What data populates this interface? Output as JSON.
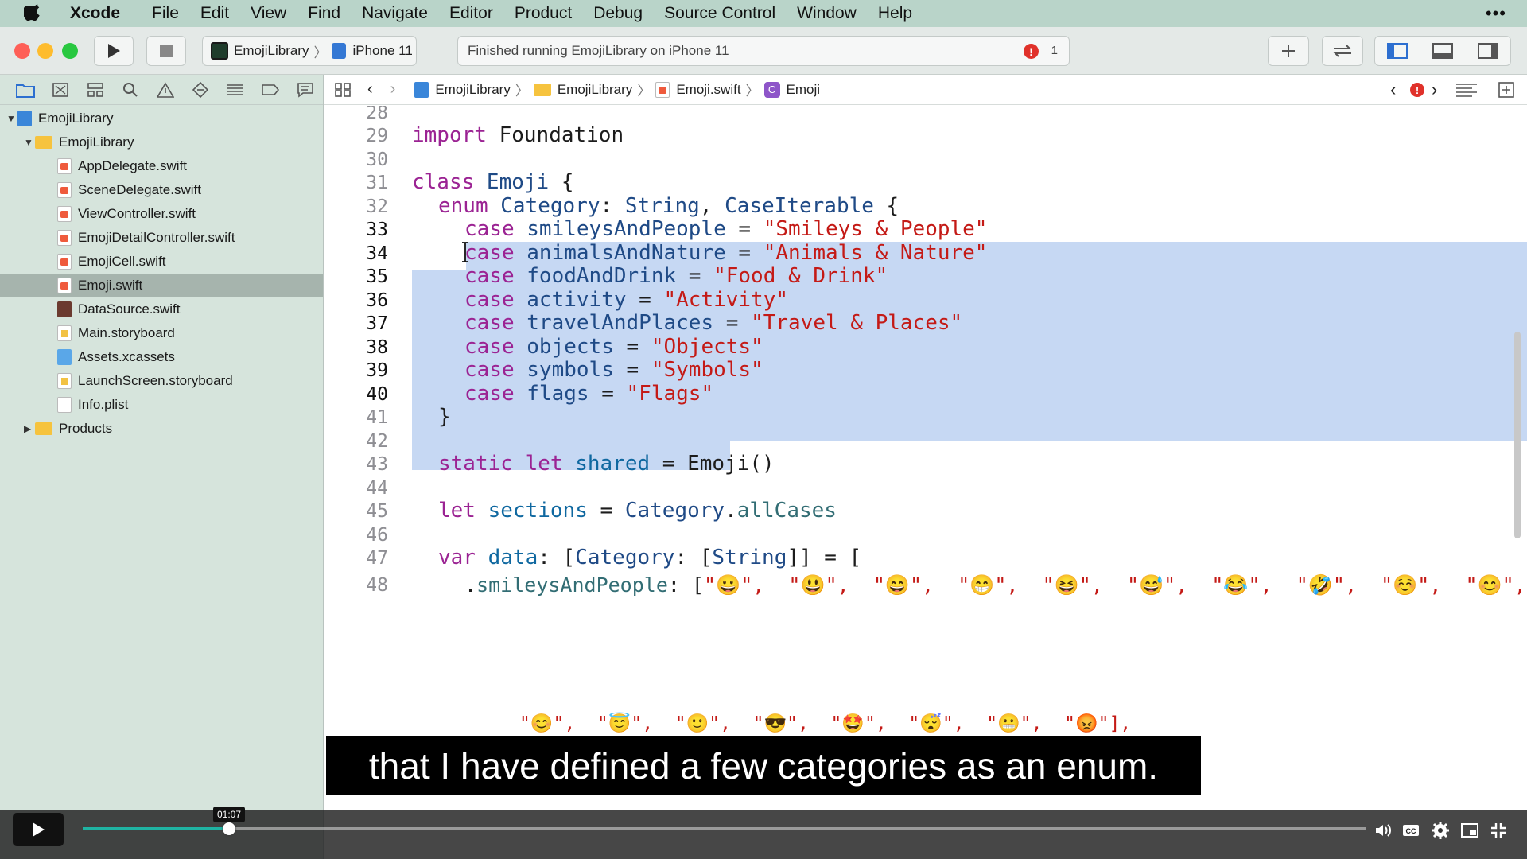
{
  "menubar": {
    "app": "Xcode",
    "items": [
      "File",
      "Edit",
      "View",
      "Find",
      "Navigate",
      "Editor",
      "Product",
      "Debug",
      "Source Control",
      "Window",
      "Help"
    ]
  },
  "toolbar": {
    "scheme": "EmojiLibrary",
    "destination": "iPhone 11",
    "activity": "Finished running EmojiLibrary on iPhone 11",
    "error_count": "1"
  },
  "navigator": {
    "tree": [
      {
        "label": "EmojiLibrary",
        "icon": "project-icon",
        "level": 0,
        "expanded": true
      },
      {
        "label": "EmojiLibrary",
        "icon": "folder-icon",
        "level": 1,
        "expanded": true
      },
      {
        "label": "AppDelegate.swift",
        "icon": "swift-file-icon",
        "level": 2
      },
      {
        "label": "SceneDelegate.swift",
        "icon": "swift-file-icon",
        "level": 2
      },
      {
        "label": "ViewController.swift",
        "icon": "swift-file-icon",
        "level": 2
      },
      {
        "label": "EmojiDetailController.swift",
        "icon": "swift-file-icon",
        "level": 2
      },
      {
        "label": "EmojiCell.swift",
        "icon": "swift-file-icon",
        "level": 2
      },
      {
        "label": "Emoji.swift",
        "icon": "swift-file-icon",
        "level": 2,
        "selected": true
      },
      {
        "label": "DataSource.swift",
        "icon": "swift-file-icon",
        "level": 2
      },
      {
        "label": "Main.storyboard",
        "icon": "storyboard-icon",
        "level": 2
      },
      {
        "label": "Assets.xcassets",
        "icon": "assets-icon",
        "level": 2
      },
      {
        "label": "LaunchScreen.storyboard",
        "icon": "storyboard-icon",
        "level": 2
      },
      {
        "label": "Info.plist",
        "icon": "plist-icon",
        "level": 2
      },
      {
        "label": "Products",
        "icon": "folder-icon",
        "level": 1,
        "expanded": false
      }
    ]
  },
  "jumpbar": {
    "crumbs": [
      "EmojiLibrary",
      "EmojiLibrary",
      "Emoji.swift",
      "Emoji"
    ]
  },
  "editor": {
    "line_numbers": [
      "28",
      "29",
      "30",
      "31",
      "32",
      "33",
      "34",
      "35",
      "36",
      "37",
      "38",
      "39",
      "40",
      "41",
      "42",
      "43",
      "44",
      "45",
      "46",
      "47",
      "48"
    ],
    "code": {
      "l29": {
        "kw": "import",
        "rest": " Foundation"
      },
      "l31": {
        "kw": "class",
        "name": " Emoji",
        "rest": " {"
      },
      "l32": {
        "kw": "enum",
        "name": " Category",
        "colon": ": ",
        "t1": "String",
        "comma": ", ",
        "t2": "CaseIterable",
        "rest": " {"
      },
      "cases": [
        {
          "name": "smileysAndPeople",
          "value": "\"Smileys & People\""
        },
        {
          "name": "animalsAndNature",
          "value": "\"Animals & Nature\""
        },
        {
          "name": "foodAndDrink",
          "value": "\"Food & Drink\""
        },
        {
          "name": "activity",
          "value": "\"Activity\""
        },
        {
          "name": "travelAndPlaces",
          "value": "\"Travel & Places\""
        },
        {
          "name": "objects",
          "value": "\"Objects\""
        },
        {
          "name": "symbols",
          "value": "\"Symbols\""
        },
        {
          "name": "flags",
          "value": "\"Flags\""
        }
      ],
      "case_kw": "case",
      "l41": "}",
      "l43": {
        "kw1": "static",
        "kw2": "let",
        "name": "shared",
        "rest": " = ",
        "call": "Emoji()"
      },
      "l45": {
        "kw": "let",
        "name": "sections",
        "rest": " = ",
        "t": "Category",
        "dot": ".",
        "prop": "allCases"
      },
      "l47": {
        "kw": "var",
        "name": "data",
        "rest": ": [",
        "t1": "Category",
        "mid": ": [",
        "t2": "String",
        "end": "]] = ["
      },
      "l48": {
        "dot": ".",
        "prop": "smileysAndPeople",
        "rest": ": [",
        "emojis": "\"😀\",  \"😃\",  \"😄\",  \"😁\",  \"😆\",  \"😅\",  \"😂\",  \"🤣\",  \"☺️\",  \"😊\","
      },
      "l48b": "\"😊\",  \"😇\",  \"🙂\",  \"😎\",  \"🤩\",  \"😴\",  \"😬\",  \"😡\"],"
    }
  },
  "subtitle": "that I have defined a few categories as an enum.",
  "video": {
    "time": "01:07",
    "progress": 0.114
  },
  "colors": {
    "menubar": "#b9d4c9",
    "navigator": "#d6e4dc",
    "selection": "#c6d8f3",
    "keyword": "#9b2393",
    "string": "#c41a16"
  }
}
